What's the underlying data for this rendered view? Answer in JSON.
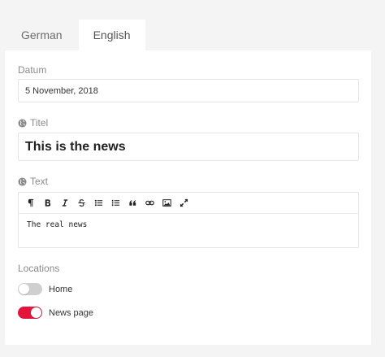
{
  "tabs": [
    {
      "label": "German",
      "active": false
    },
    {
      "label": "English",
      "active": true
    }
  ],
  "form": {
    "date_label": "Datum",
    "date_value": "5 November, 2018",
    "title_label": "Titel",
    "title_value": "This is the news",
    "text_label": "Text",
    "text_value": "The real news",
    "locations_label": "Locations"
  },
  "toolbar": {
    "icons": [
      "paragraph-icon",
      "bold-icon",
      "italic-icon",
      "strikethrough-icon",
      "bullet-list-icon",
      "ordered-list-icon",
      "quote-icon",
      "link-icon",
      "image-icon",
      "fullscreen-icon"
    ]
  },
  "locations": [
    {
      "label": "Home",
      "enabled": false
    },
    {
      "label": "News page",
      "enabled": true
    }
  ],
  "colors": {
    "accent": "#e2143c",
    "toggle_off": "#cfcfcf",
    "background": "#f4f4f4"
  }
}
